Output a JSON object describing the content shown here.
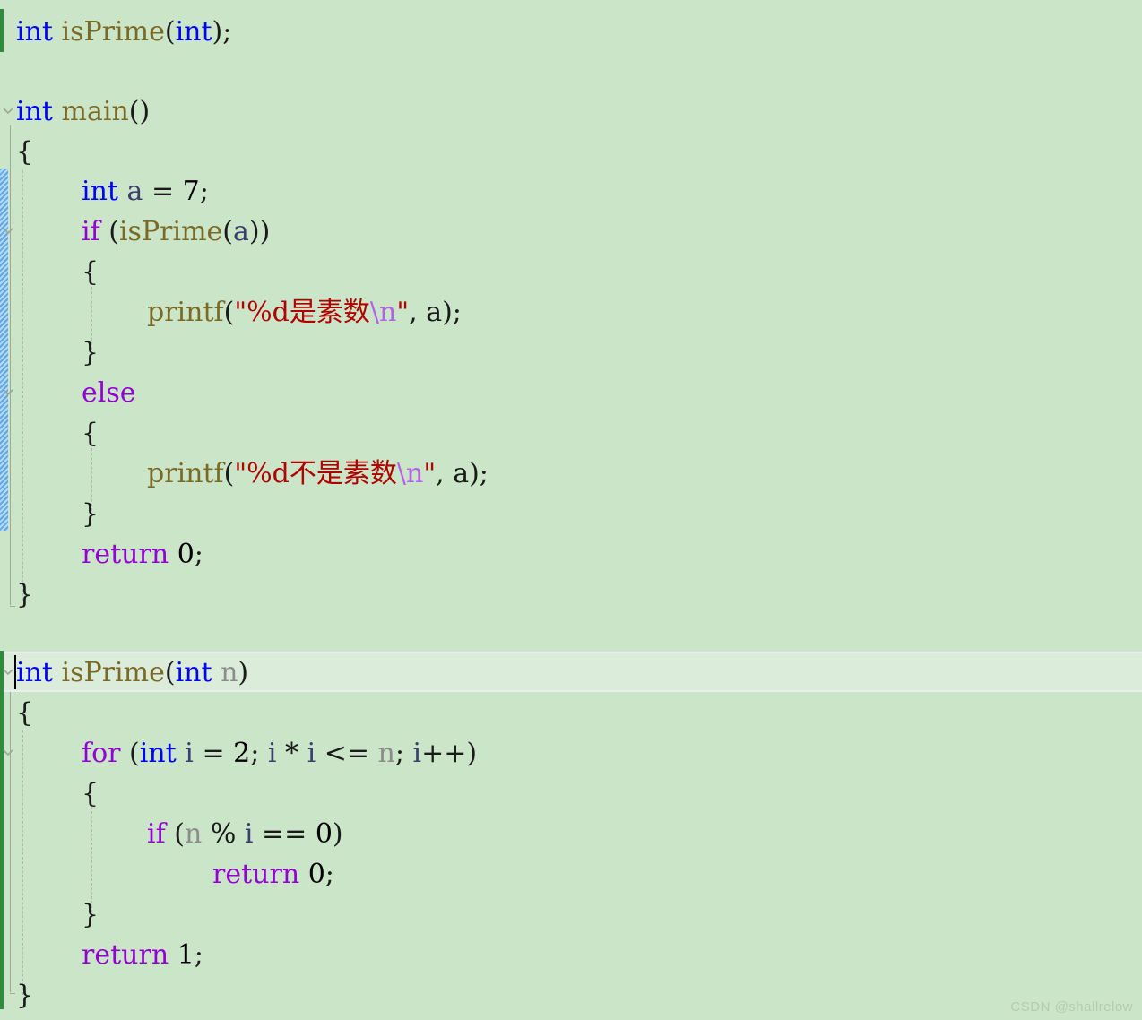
{
  "editor": {
    "background_color": "#cbe5c8",
    "current_line_color": "#dcecdb",
    "language": "C",
    "font_size_px": 30,
    "line_height_px": 45
  },
  "colors": {
    "keyword_type": "#0000ff",
    "keyword_control": "#9400d3",
    "function_name": "#7a6a26",
    "variable": "#3b3f6e",
    "parameter": "#8c8c8c",
    "string": "#b00000",
    "escape": "#b560e8",
    "punctuation": "#1a1a1a",
    "change_bar_added": "#2e8b3a",
    "change_bar_modified": "#5da8e8",
    "watermark": "#b7c9b5"
  },
  "code": {
    "line1": {
      "indent": "",
      "tokens": "int isPrime(int);"
    },
    "line2": {
      "indent": "",
      "tokens": ""
    },
    "line3": {
      "indent": "",
      "tokens": "int main()"
    },
    "line4": {
      "indent": "",
      "tokens": "{"
    },
    "line5": {
      "indent": "",
      "tokens": ""
    },
    "line6": {
      "indent": "    ",
      "tokens": "int a = 7;"
    },
    "line7": {
      "indent": "    ",
      "tokens": "if (isPrime(a))"
    },
    "line8": {
      "indent": "    ",
      "tokens": "{"
    },
    "line9": {
      "indent": "        ",
      "tokens": "printf(\"%d是素数\\n\", a);"
    },
    "line10": {
      "indent": "    ",
      "tokens": "}"
    },
    "line11": {
      "indent": "    ",
      "tokens": "else"
    },
    "line12": {
      "indent": "    ",
      "tokens": "{"
    },
    "line13": {
      "indent": "        ",
      "tokens": "printf(\"%d不是素数\\n\", a);"
    },
    "line14": {
      "indent": "    ",
      "tokens": "}"
    },
    "line15": {
      "indent": "    ",
      "tokens": "return 0;"
    },
    "line16": {
      "indent": "",
      "tokens": "}"
    },
    "line17": {
      "indent": "",
      "tokens": ""
    },
    "line18": {
      "indent": "",
      "tokens": "int isPrime(int n)"
    },
    "line19": {
      "indent": "",
      "tokens": "{"
    },
    "line20": {
      "indent": "    ",
      "tokens": "for (int i = 2; i * i <= n; i++)"
    },
    "line21": {
      "indent": "    ",
      "tokens": "{"
    },
    "line22": {
      "indent": "        ",
      "tokens": "if (n % i == 0)"
    },
    "line23": {
      "indent": "            ",
      "tokens": "return 0;"
    },
    "line24": {
      "indent": "    ",
      "tokens": "}"
    },
    "line25": {
      "indent": "    ",
      "tokens": "return 1;"
    },
    "line26": {
      "indent": "",
      "tokens": "}"
    }
  },
  "tokens": {
    "kw_int": "int",
    "kw_if": "if",
    "kw_else": "else",
    "kw_for": "for",
    "kw_return": "return",
    "fn_isPrime": "isPrime",
    "fn_main": "main",
    "fn_printf": "printf",
    "var_a": "a",
    "var_i": "i",
    "param_n": "n",
    "num_0": "0",
    "num_1": "1",
    "num_2": "2",
    "num_7": "7",
    "open_paren": "(",
    "close_paren": ")",
    "open_brace": "{",
    "close_brace": "}",
    "semicolon": ";",
    "comma": ",",
    "space": " ",
    "assign": " = ",
    "quote_open": "\"",
    "quote_close": "\"",
    "str_prime": "%d是素数",
    "str_not_prime": "%d不是素数",
    "escape_newline": "\\n",
    "decl_tail": "();",
    "line1_tail": ");",
    "main_parens": "()",
    "if_cond_open": " (",
    "isPrime_call_a": "(a))",
    "printf_open": "(",
    "printf_tail": ", a);",
    "for_header": " (int i = 2; i * i <= n; i++)",
    "for_init": "int",
    "for_rest_1": " i = 2; i * i <= n; i++)",
    "if_n_cond": " (n % i == 0)",
    "isPrime_def_tail": "(int n)"
  },
  "watermark": {
    "text": "CSDN @shallrelow"
  },
  "gutter": {
    "fold_markers": [
      "chevron-down",
      "chevron-down",
      "chevron-down",
      "chevron-down",
      "chevron-down"
    ],
    "change_bars": [
      {
        "type": "added",
        "color": "#2e8b3a"
      },
      {
        "type": "modified",
        "color": "#5da8e8"
      }
    ]
  }
}
